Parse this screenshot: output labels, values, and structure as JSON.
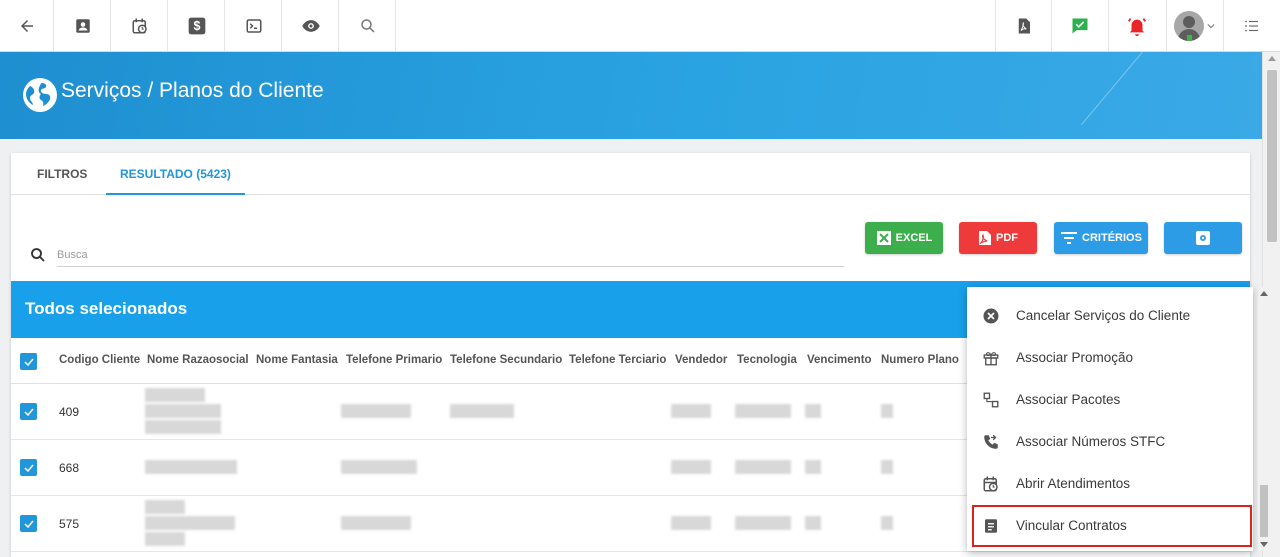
{
  "toolbar": {
    "left_icons": [
      "back-arrow-icon",
      "contact-card-icon",
      "calendar-clock-icon",
      "dollar-icon",
      "terminal-icon",
      "eye-icon",
      "search-icon"
    ],
    "right_icons": [
      "pdf-icon",
      "chat-check-icon",
      "alarm-bell-icon",
      "avatar",
      "list-menu-icon"
    ]
  },
  "header": {
    "title": "Serviços / Planos do Cliente"
  },
  "tabs": [
    {
      "label": "FILTROS",
      "active": false
    },
    {
      "label": "RESULTADO (5423)",
      "active": true
    }
  ],
  "search": {
    "placeholder": "Busca"
  },
  "buttons": {
    "excel": "EXCEL",
    "pdf": "PDF",
    "criterios": "CRITÉRIOS"
  },
  "selection": {
    "text": "Todos selecionados"
  },
  "table": {
    "columns": [
      "Codigo Cliente",
      "Nome Razaosocial",
      "Nome Fantasia",
      "Telefone Primario",
      "Telefone Secundario",
      "Telefone Terciario",
      "Vendedor",
      "Tecnologia",
      "Vencimento",
      "Numero Plano"
    ],
    "rows": [
      {
        "codigo": "409",
        "checked": true
      },
      {
        "codigo": "668",
        "checked": true
      },
      {
        "codigo": "575",
        "checked": true
      }
    ]
  },
  "menu": {
    "items": [
      {
        "label": "Cancelar Serviços do Cliente",
        "icon": "cancel-circle-icon"
      },
      {
        "label": "Associar Promoção",
        "icon": "gift-icon"
      },
      {
        "label": "Associar Pacotes",
        "icon": "packages-icon"
      },
      {
        "label": "Associar Números STFC",
        "icon": "phone-forward-icon"
      },
      {
        "label": "Abrir Atendimentos",
        "icon": "calendar-clock-icon"
      },
      {
        "label": "Vincular Contratos",
        "icon": "document-icon",
        "highlighted": true
      }
    ]
  },
  "colors": {
    "header_blue": "#1e8fd0",
    "selection_blue": "#18a0ea",
    "accent_blue": "#2196d8",
    "excel_green": "#3cae4c",
    "pdf_red": "#ee3a3a",
    "highlight_red": "#d9241c",
    "chat_green": "#2bb24c",
    "alarm_red": "#e8262a"
  }
}
